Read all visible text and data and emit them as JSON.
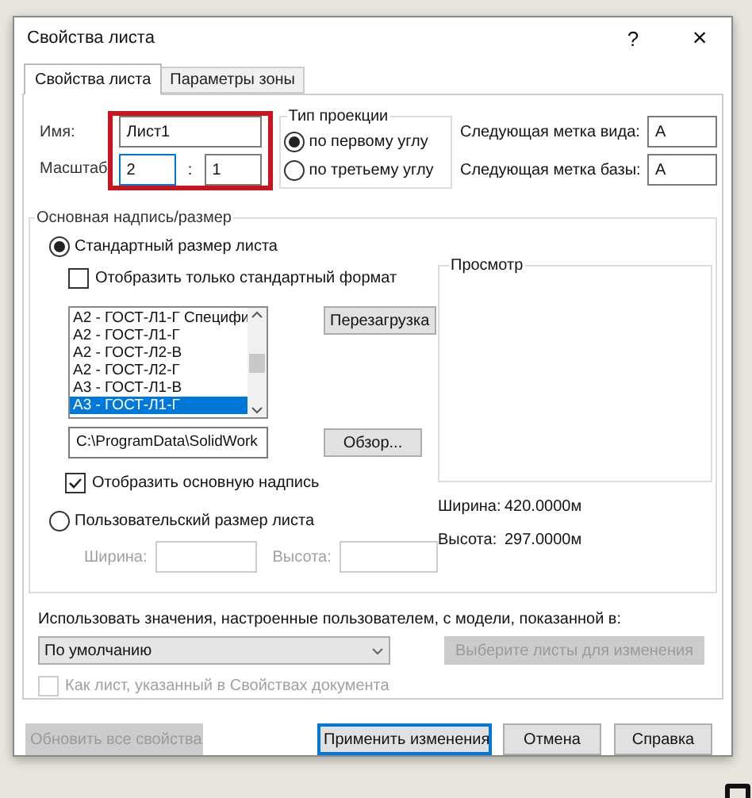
{
  "window": {
    "title": "Свойства листа",
    "help": "?",
    "close": "×"
  },
  "tabs": [
    {
      "label": "Свойства листа",
      "selected": true
    },
    {
      "label": "Параметры зоны",
      "selected": false
    }
  ],
  "name": {
    "label": "Имя:",
    "value": "Лист1"
  },
  "scale": {
    "label": "Масштаб",
    "value_1": "2",
    "separator": ":",
    "value_2": "1"
  },
  "projection": {
    "title": "Тип проекции",
    "options": [
      {
        "label": "по первому углу",
        "selected": true
      },
      {
        "label": "по третьему углу",
        "selected": false
      }
    ]
  },
  "next_labels": [
    {
      "label": "Следующая метка вида:",
      "value": "A"
    },
    {
      "label": "Следующая метка базы:",
      "value": "A"
    }
  ],
  "sheet_format": {
    "title": "Основная надпись/размер",
    "standard": {
      "label": "Стандартный размер листа",
      "selected": true
    },
    "only_standard": {
      "label": "Отобразить только стандартный формат",
      "checked": false
    },
    "formats": [
      {
        "label": "A2 - ГОСТ-Л1-Г Специфи",
        "selected": false
      },
      {
        "label": "A2 - ГОСТ-Л1-Г",
        "selected": false
      },
      {
        "label": "A2 - ГОСТ-Л2-В",
        "selected": false
      },
      {
        "label": "A2 - ГОСТ-Л2-Г",
        "selected": false
      },
      {
        "label": "A3 - ГОСТ-Л1-В",
        "selected": false
      },
      {
        "label": "A3 - ГОСТ-Л1-Г",
        "selected": true
      }
    ],
    "reload_button": "Перезагрузка",
    "path": "C:\\ProgramData\\SolidWork",
    "browse_button": "Обзор...",
    "show_title_block": {
      "label": "Отобразить основную надпись",
      "checked": true
    },
    "custom": {
      "label": "Пользовательский размер листа",
      "selected": false
    },
    "custom_width_label": "Ширина:",
    "custom_height_label": "Высота:",
    "preview_title": "Просмотр",
    "readings": [
      {
        "label": "Ширина:",
        "value": "420.0000м"
      },
      {
        "label": "Высота:",
        "value": "297.0000м"
      }
    ]
  },
  "use_values_label": "Использовать значения, настроенные пользователем, с модели, показанной в:",
  "model_select": "По умолчанию",
  "select_sheets_button": {
    "label": "Выберите листы для изменения",
    "disabled": true
  },
  "as_document": {
    "label": "Как лист, указанный в Свойствах документа",
    "checked": false,
    "disabled": true
  },
  "buttons": [
    {
      "label": "Обновить все свойства",
      "disabled": true,
      "default": false
    },
    {
      "label": "Применить изменения",
      "disabled": false,
      "default": true
    },
    {
      "label": "Отмена",
      "disabled": false,
      "default": false
    },
    {
      "label": "Справка",
      "disabled": false,
      "default": false
    }
  ]
}
